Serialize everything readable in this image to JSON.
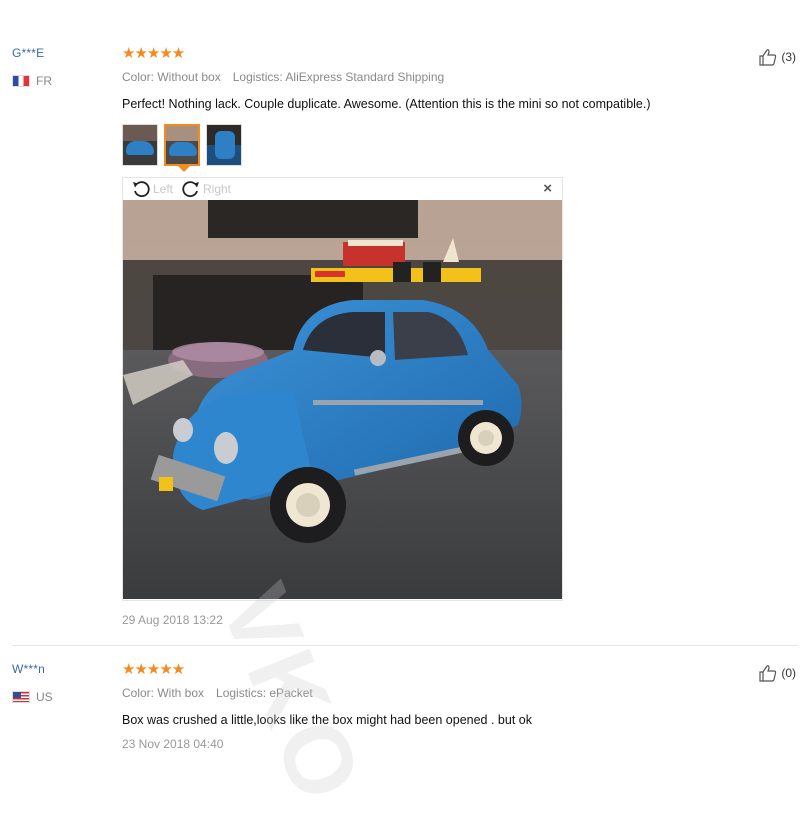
{
  "reviews": [
    {
      "user": "G***E",
      "country": "FR",
      "stars": "★★★★★",
      "color_label": "Color: Without box",
      "logistics_label": "Logistics: AliExpress Standard Shipping",
      "text": "Perfect! Nothing lack. Couple duplicate. Awesome. (Attention this is the mini so not compatible.)",
      "likes": "(3)",
      "date": "29 Aug 2018 13:22"
    },
    {
      "user": "W***n",
      "country": "US",
      "stars": "★★★★★",
      "color_label": "Color: With box",
      "logistics_label": "Logistics: ePacket",
      "text": "Box was crushed a little,looks like the box might had been opened . but ok",
      "likes": "(0)",
      "date": "23 Nov 2018 04:40"
    }
  ],
  "viewer": {
    "rotate_left_label": "Left",
    "rotate_right_label": "Right",
    "close_label": "×",
    "selected_thumbnail": 2,
    "thumbnail_count": 3
  },
  "watermark": "VKO",
  "colors": {
    "star": "#f58a1e",
    "username": "#3b6aa0",
    "car": "#2f7fc4"
  }
}
